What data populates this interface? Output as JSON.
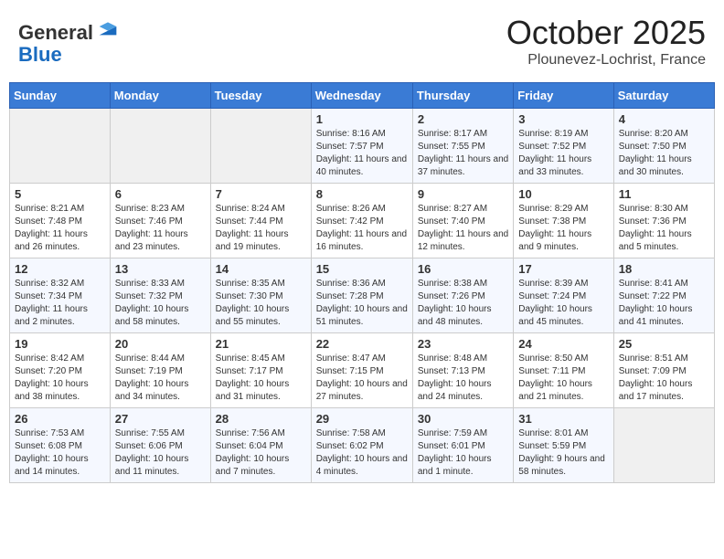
{
  "header": {
    "logo": {
      "line1": "General",
      "line2": "Blue"
    },
    "month": "October 2025",
    "location": "Plounevez-Lochrist, France"
  },
  "weekdays": [
    "Sunday",
    "Monday",
    "Tuesday",
    "Wednesday",
    "Thursday",
    "Friday",
    "Saturday"
  ],
  "weeks": [
    [
      {
        "day": "",
        "info": ""
      },
      {
        "day": "",
        "info": ""
      },
      {
        "day": "",
        "info": ""
      },
      {
        "day": "1",
        "info": "Sunrise: 8:16 AM\nSunset: 7:57 PM\nDaylight: 11 hours and 40 minutes."
      },
      {
        "day": "2",
        "info": "Sunrise: 8:17 AM\nSunset: 7:55 PM\nDaylight: 11 hours and 37 minutes."
      },
      {
        "day": "3",
        "info": "Sunrise: 8:19 AM\nSunset: 7:52 PM\nDaylight: 11 hours and 33 minutes."
      },
      {
        "day": "4",
        "info": "Sunrise: 8:20 AM\nSunset: 7:50 PM\nDaylight: 11 hours and 30 minutes."
      }
    ],
    [
      {
        "day": "5",
        "info": "Sunrise: 8:21 AM\nSunset: 7:48 PM\nDaylight: 11 hours and 26 minutes."
      },
      {
        "day": "6",
        "info": "Sunrise: 8:23 AM\nSunset: 7:46 PM\nDaylight: 11 hours and 23 minutes."
      },
      {
        "day": "7",
        "info": "Sunrise: 8:24 AM\nSunset: 7:44 PM\nDaylight: 11 hours and 19 minutes."
      },
      {
        "day": "8",
        "info": "Sunrise: 8:26 AM\nSunset: 7:42 PM\nDaylight: 11 hours and 16 minutes."
      },
      {
        "day": "9",
        "info": "Sunrise: 8:27 AM\nSunset: 7:40 PM\nDaylight: 11 hours and 12 minutes."
      },
      {
        "day": "10",
        "info": "Sunrise: 8:29 AM\nSunset: 7:38 PM\nDaylight: 11 hours and 9 minutes."
      },
      {
        "day": "11",
        "info": "Sunrise: 8:30 AM\nSunset: 7:36 PM\nDaylight: 11 hours and 5 minutes."
      }
    ],
    [
      {
        "day": "12",
        "info": "Sunrise: 8:32 AM\nSunset: 7:34 PM\nDaylight: 11 hours and 2 minutes."
      },
      {
        "day": "13",
        "info": "Sunrise: 8:33 AM\nSunset: 7:32 PM\nDaylight: 10 hours and 58 minutes."
      },
      {
        "day": "14",
        "info": "Sunrise: 8:35 AM\nSunset: 7:30 PM\nDaylight: 10 hours and 55 minutes."
      },
      {
        "day": "15",
        "info": "Sunrise: 8:36 AM\nSunset: 7:28 PM\nDaylight: 10 hours and 51 minutes."
      },
      {
        "day": "16",
        "info": "Sunrise: 8:38 AM\nSunset: 7:26 PM\nDaylight: 10 hours and 48 minutes."
      },
      {
        "day": "17",
        "info": "Sunrise: 8:39 AM\nSunset: 7:24 PM\nDaylight: 10 hours and 45 minutes."
      },
      {
        "day": "18",
        "info": "Sunrise: 8:41 AM\nSunset: 7:22 PM\nDaylight: 10 hours and 41 minutes."
      }
    ],
    [
      {
        "day": "19",
        "info": "Sunrise: 8:42 AM\nSunset: 7:20 PM\nDaylight: 10 hours and 38 minutes."
      },
      {
        "day": "20",
        "info": "Sunrise: 8:44 AM\nSunset: 7:19 PM\nDaylight: 10 hours and 34 minutes."
      },
      {
        "day": "21",
        "info": "Sunrise: 8:45 AM\nSunset: 7:17 PM\nDaylight: 10 hours and 31 minutes."
      },
      {
        "day": "22",
        "info": "Sunrise: 8:47 AM\nSunset: 7:15 PM\nDaylight: 10 hours and 27 minutes."
      },
      {
        "day": "23",
        "info": "Sunrise: 8:48 AM\nSunset: 7:13 PM\nDaylight: 10 hours and 24 minutes."
      },
      {
        "day": "24",
        "info": "Sunrise: 8:50 AM\nSunset: 7:11 PM\nDaylight: 10 hours and 21 minutes."
      },
      {
        "day": "25",
        "info": "Sunrise: 8:51 AM\nSunset: 7:09 PM\nDaylight: 10 hours and 17 minutes."
      }
    ],
    [
      {
        "day": "26",
        "info": "Sunrise: 7:53 AM\nSunset: 6:08 PM\nDaylight: 10 hours and 14 minutes."
      },
      {
        "day": "27",
        "info": "Sunrise: 7:55 AM\nSunset: 6:06 PM\nDaylight: 10 hours and 11 minutes."
      },
      {
        "day": "28",
        "info": "Sunrise: 7:56 AM\nSunset: 6:04 PM\nDaylight: 10 hours and 7 minutes."
      },
      {
        "day": "29",
        "info": "Sunrise: 7:58 AM\nSunset: 6:02 PM\nDaylight: 10 hours and 4 minutes."
      },
      {
        "day": "30",
        "info": "Sunrise: 7:59 AM\nSunset: 6:01 PM\nDaylight: 10 hours and 1 minute."
      },
      {
        "day": "31",
        "info": "Sunrise: 8:01 AM\nSunset: 5:59 PM\nDaylight: 9 hours and 58 minutes."
      },
      {
        "day": "",
        "info": ""
      }
    ]
  ]
}
